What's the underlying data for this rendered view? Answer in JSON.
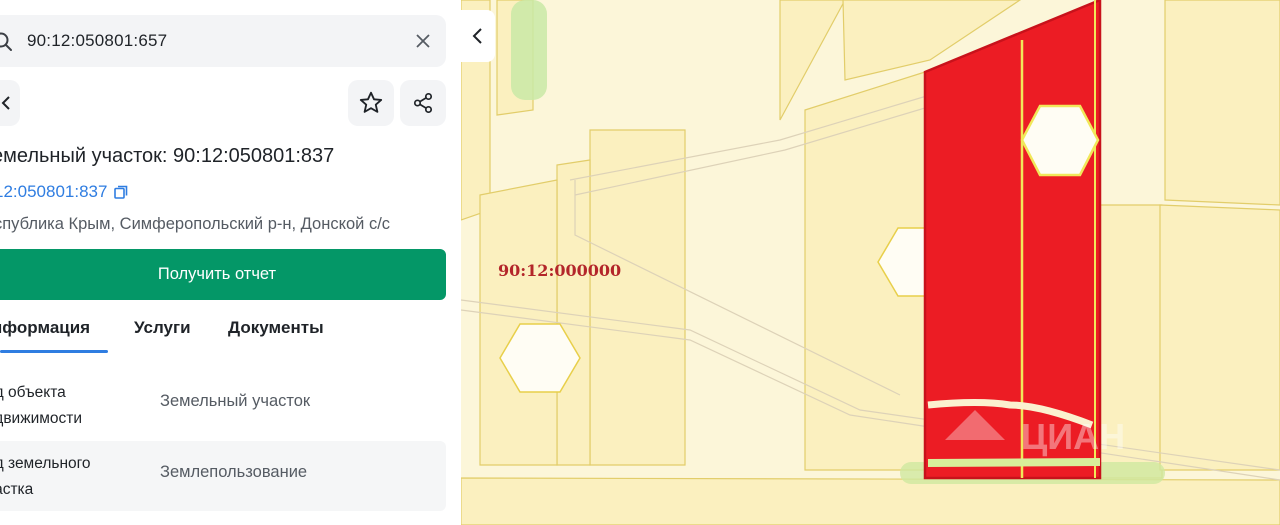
{
  "search": {
    "query": "90:12:050801:657",
    "clear_icon": "close-icon",
    "search_icon": "search-icon"
  },
  "toolbar": {
    "back_icon": "chevron-left-icon",
    "favorite_icon": "star-icon",
    "share_icon": "share-icon"
  },
  "object": {
    "title": "емельный участок: 90:12:050801:837",
    "cadastral_number": "12:050801:837",
    "copy_icon": "copy-icon",
    "address": "спублика Крым, Симферопольский р-н, Донской с/с"
  },
  "report_button": {
    "label": "Получить отчет",
    "color": "#049767"
  },
  "tabs": [
    {
      "label": "нформация",
      "active": true
    },
    {
      "label": "Услуги",
      "active": false
    },
    {
      "label": "Документы",
      "active": false
    }
  ],
  "details": [
    {
      "label_line1": "ид объекта",
      "label_line2": "едвижимости",
      "value": "Земельный участок"
    },
    {
      "label_line1": "ид земельного",
      "label_line2": "частка",
      "value": "Землепользование"
    }
  ],
  "map": {
    "label": "90:12:000000",
    "collapse_icon": "chevron-left-icon",
    "highlight_color": "#ec1c24",
    "watermark": "ЦИАН"
  }
}
